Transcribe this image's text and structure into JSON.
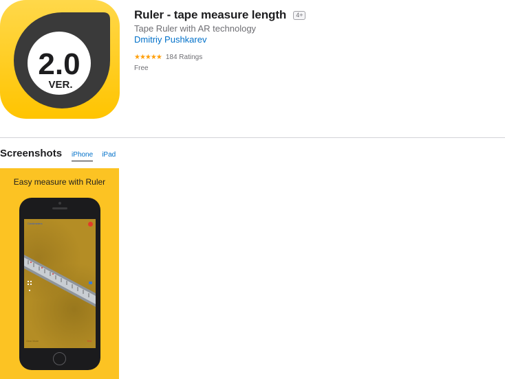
{
  "app": {
    "title": "Ruler - tape measure length",
    "age_rating": "4+",
    "subtitle": "Tape Ruler with AR technology",
    "developer": "Dmitriy Pushkarev",
    "stars": "★★★★★",
    "rating_count": "184 Ratings",
    "price": "Free",
    "icon": {
      "version_number": "2.0",
      "version_label": "VER.",
      "colors": {
        "background": "#ffc400",
        "ring": "#3a3a3a",
        "inner": "#ffffff"
      }
    }
  },
  "screenshots": {
    "section_title": "Screenshots",
    "tabs": [
      {
        "label": "iPhone",
        "active": true
      },
      {
        "label": "iPad",
        "active": false
      }
    ],
    "items": [
      {
        "caption": "Easy measure with Ruler",
        "screen_label": "Centimeters",
        "bottom_left": "Clear   Mode",
        "bottom_right": "End"
      }
    ]
  },
  "colors": {
    "link": "#0070c9",
    "star": "#ff9f0a",
    "screenshot_bg": "#fcc323"
  }
}
